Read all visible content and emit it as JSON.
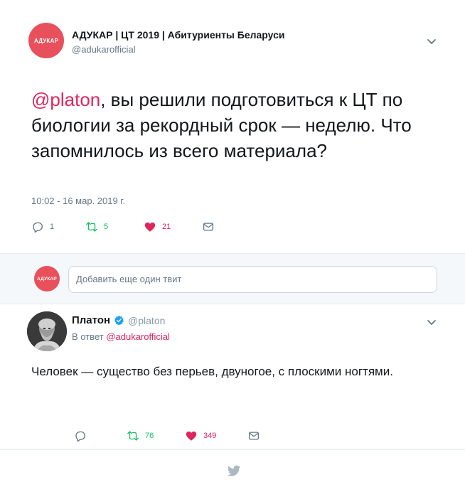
{
  "main_tweet": {
    "author_name": "АДУКАР | ЦТ 2019 | Абитуриенты Беларуси",
    "author_handle": "@adukarofficial",
    "avatar_text": "АДУКАР",
    "mention": "@platon",
    "text": ", вы решили подготовиться к ЦТ по биологии за рекордный срок — неделю. Что запомнилось из всего материала?",
    "timestamp": "10:02 - 16 мар. 2019 г.",
    "reply_count": "1",
    "retweet_count": "5",
    "like_count": "21"
  },
  "reply_composer": {
    "avatar_text": "АДУКАР",
    "placeholder": "Добавить еще один твит"
  },
  "reply_tweet": {
    "author_name": "Платон",
    "author_handle": "@platon",
    "in_reply_prefix": "В ответ",
    "in_reply_mention": "@adukarofficial",
    "text": "Человек — существо без перьев, двуногое, с плоскими ногтями.",
    "reply_count": "",
    "retweet_count": "76",
    "like_count": "349"
  },
  "colors": {
    "brand": "#e8505b",
    "mention": "#e0245e",
    "retweet": "#17bf63",
    "like": "#e0245e",
    "muted": "#657786",
    "verified": "#1da1f2"
  },
  "icons": {
    "reply": "reply-icon",
    "retweet": "retweet-icon",
    "like": "heart-icon",
    "dm": "envelope-icon",
    "menu": "chevron-down-icon",
    "footer": "twitter-bird-icon"
  }
}
